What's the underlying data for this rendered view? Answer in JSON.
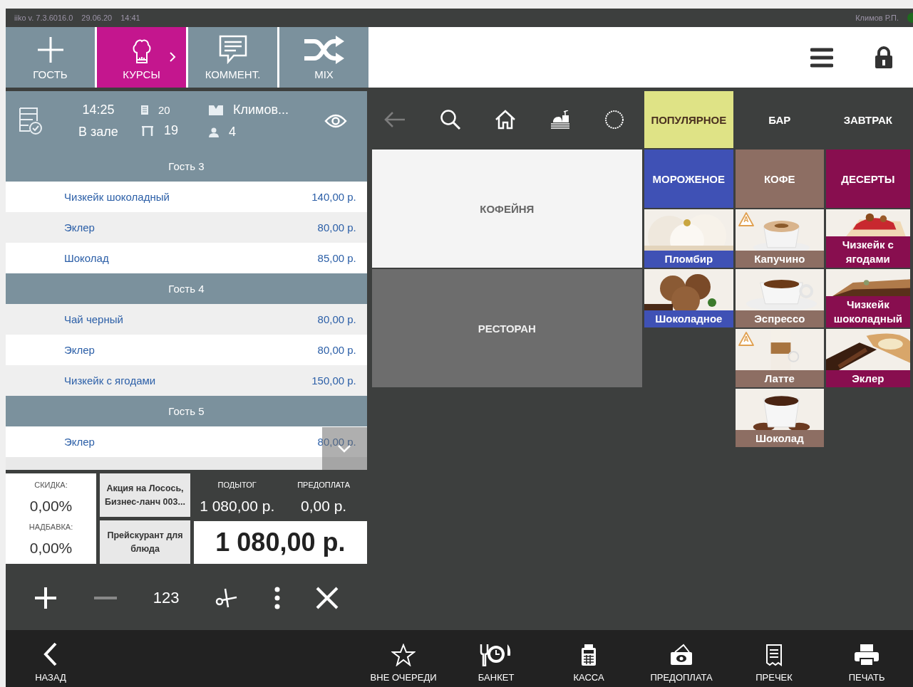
{
  "status_bar": {
    "version": "iiko  v. 7.3.6016.0",
    "date": "29.06.20",
    "time": "14:41",
    "user": "Климов Р.П.",
    "online": true
  },
  "toolbar": [
    {
      "label": "ГОСТЬ",
      "selected": false
    },
    {
      "label": "КУРСЫ",
      "selected": true
    },
    {
      "label": "КОММЕНТ.",
      "selected": false
    },
    {
      "label": "MIX",
      "selected": false
    }
  ],
  "order_header": {
    "time": "14:25",
    "location": "В зале",
    "order_number": "20",
    "table": "19",
    "waiter": "Климов...",
    "guests": "4"
  },
  "guests": [
    {
      "title": "Гость 3",
      "items": [
        {
          "name": "Чизкейк шоколадный",
          "price": "140,00 р."
        },
        {
          "name": "Эклер",
          "price": "80,00 р."
        },
        {
          "name": "Шоколад",
          "price": "85,00 р."
        }
      ]
    },
    {
      "title": "Гость 4",
      "items": [
        {
          "name": "Чай черный",
          "price": "80,00 р."
        },
        {
          "name": "Эклер",
          "price": "80,00 р."
        },
        {
          "name": "Чизкейк с ягодами",
          "price": "150,00 р."
        }
      ]
    },
    {
      "title": "Гость 5",
      "items": [
        {
          "name": "Эклер",
          "price": "80,00 р."
        }
      ]
    }
  ],
  "totals": {
    "discount_label": "СКИДКА:",
    "discount": "0,00%",
    "surcharge_label": "НАДБАВКА:",
    "surcharge": "0,00%",
    "promo_button": "Акция на Лосось, Бизнес-ланч 003...",
    "pricelist_button": "Прейскурант для блюда",
    "subtotal_label": "ПОДЫТОГ",
    "subtotal": "1 080,00 р.",
    "prepay_label": "ПРЕДОПЛАТА",
    "prepay": "0,00 р.",
    "total": "1 080,00 р."
  },
  "actions": {
    "quantity_button": "123"
  },
  "back_button": {
    "disabled": true
  },
  "top_categories": [
    {
      "label": "ПОПУЛЯРНОЕ",
      "selected": true
    },
    {
      "label": "БАР",
      "selected": false
    },
    {
      "label": "ЗАВТРАК",
      "selected": false
    }
  ],
  "categories": [
    {
      "label": "МОРОЖЕНОЕ",
      "color": "#3f51b5"
    },
    {
      "label": "КОФЕ",
      "color": "#8d6e63"
    },
    {
      "label": "ДЕСЕРТЫ",
      "color": "#880e4f"
    }
  ],
  "halls": [
    {
      "label": "КОФЕЙНЯ",
      "selected": true
    },
    {
      "label": "РЕСТОРАН",
      "selected": false
    }
  ],
  "product_columns": [
    {
      "items": [
        {
          "name": "Пломбир",
          "color": "#3f51b5"
        },
        {
          "name": "Шоколадное",
          "color": "#3f51b5"
        }
      ]
    },
    {
      "items": [
        {
          "name": "Капучино",
          "color": "#8d6e63",
          "badge": "A"
        },
        {
          "name": "Эспрессо",
          "color": "#8d6e63"
        },
        {
          "name": "Латте",
          "color": "#8d6e63",
          "badge": "A"
        },
        {
          "name": "Шоколад",
          "color": "#8d6e63"
        }
      ]
    },
    {
      "items": [
        {
          "name": "Чизкейк с ягодами",
          "color": "#880e4f"
        },
        {
          "name": "Чизкейк шоколадный",
          "color": "#880e4f"
        },
        {
          "name": "Эклер",
          "color": "#880e4f"
        }
      ]
    }
  ],
  "bottom_bar": [
    {
      "label": "НАЗАД"
    },
    {
      "label": "ВНЕ ОЧЕРЕДИ"
    },
    {
      "label": "БАНКЕТ"
    },
    {
      "label": "КАССА"
    },
    {
      "label": "ПРЕДОПЛАТА"
    },
    {
      "label": "ПРЕЧЕК"
    },
    {
      "label": "ПЕЧАТЬ"
    }
  ]
}
